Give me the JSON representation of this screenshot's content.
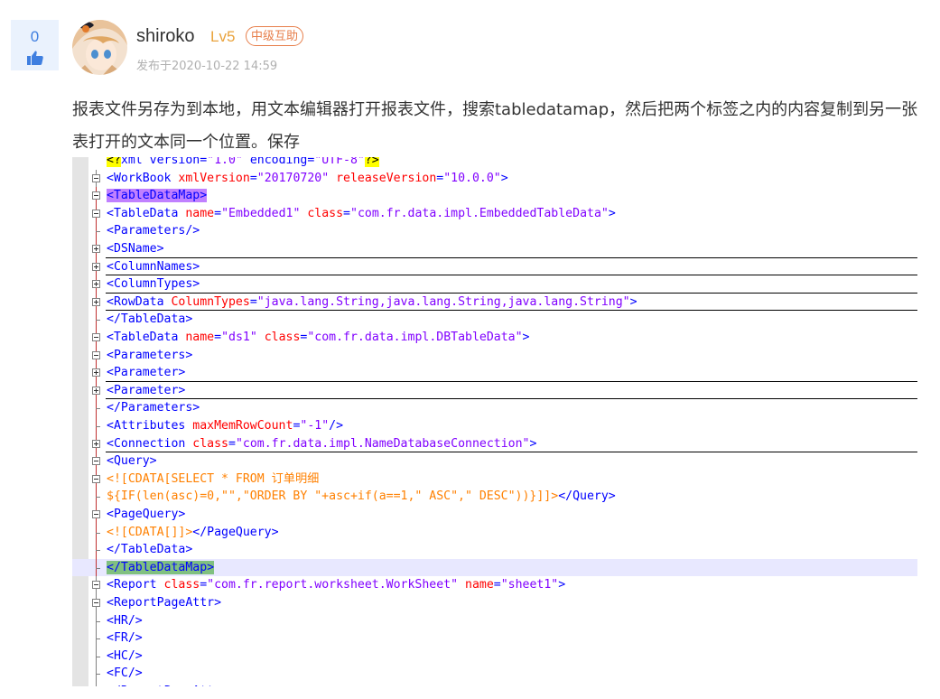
{
  "post": {
    "vote_count": "0",
    "username": "shiroko",
    "level": "Lv5",
    "badge": "中级互助",
    "post_time": "发布于2020-10-22 14:59",
    "body": "报表文件另存为到本地，用文本编辑器打开报表文件，搜索tabledatamap，然后把两个标签之内的内容复制到另一张表打开的文本同一个位置。保存"
  },
  "code_lines": [
    "<?xml version=\"1.0\" encoding=\"UTF-8\"?>",
    "<WorkBook xmlVersion=\"20170720\" releaseVersion=\"10.0.0\">",
    "<TableDataMap>",
    "<TableData name=\"Embedded1\" class=\"com.fr.data.impl.EmbeddedTableData\">",
    "<Parameters/>",
    "<DSName>",
    "<ColumnNames>",
    "<ColumnTypes>",
    "<RowData ColumnTypes=\"java.lang.String,java.lang.String,java.lang.String\">",
    "</TableData>",
    "<TableData name=\"ds1\" class=\"com.fr.data.impl.DBTableData\">",
    "<Parameters>",
    "<Parameter>",
    "<Parameter>",
    "</Parameters>",
    "<Attributes maxMemRowCount=\"-1\"/>",
    "<Connection class=\"com.fr.data.impl.NameDatabaseConnection\">",
    "<Query>",
    "<![CDATA[SELECT * FROM 订单明细",
    "${IF(len(asc)=0,\"\",\"ORDER BY \"+asc+if(a==1,\" ASC\",\" DESC\"))}]]></Query>",
    "<PageQuery>",
    "<![CDATA[]]></PageQuery>",
    "</TableData>",
    "</TableDataMap>",
    "<Report class=\"com.fr.report.worksheet.WorkSheet\" name=\"sheet1\">",
    "<ReportPageAttr>",
    "<HR/>",
    "<FR/>",
    "<HC/>",
    "<FC/>",
    "</ReportPageAttr>"
  ],
  "colors": {
    "accent_blue": "#3f7fe0",
    "level_orange": "#e9a23b",
    "badge_orange": "#e77e4a"
  }
}
